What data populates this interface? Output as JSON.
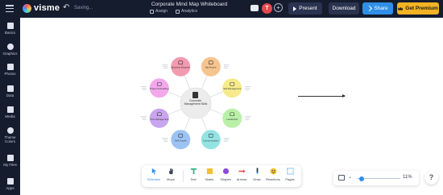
{
  "app": {
    "name": "visme",
    "status": "Saving..."
  },
  "document": {
    "title": "Corporate Mind Map Whiteboard",
    "assign_label": "Assign",
    "analytics_label": "Analytics"
  },
  "header": {
    "avatar_initial": "T",
    "add_label": "+",
    "present_label": "Present",
    "download_label": "Download",
    "share_label": "Share",
    "premium_label": "Get Premium",
    "colors": {
      "bar": "#151c2e",
      "share": "#2f8fe8",
      "premium": "#f2b322",
      "avatar": "#e5484d"
    }
  },
  "sidebar": {
    "items": [
      {
        "label": "Basics",
        "icon": "basics-icon"
      },
      {
        "label": "Graphics",
        "icon": "graphics-icon"
      },
      {
        "label": "Photos",
        "icon": "photos-icon"
      },
      {
        "label": "Data",
        "icon": "data-icon"
      },
      {
        "label": "Media",
        "icon": "media-icon"
      },
      {
        "label": "Theme Colors",
        "icon": "palette-icon"
      },
      {
        "label": "My Files",
        "icon": "folder-icon"
      },
      {
        "label": "Apps",
        "icon": "apps-icon"
      }
    ]
  },
  "mindmap": {
    "center_label": "Corporate Management Skills",
    "nodes": [
      {
        "label": "Business Etiquette",
        "color": "#f29ab0"
      },
      {
        "label": "Big Picture",
        "color": "#f6c48f"
      },
      {
        "label": "Self-Management",
        "color": "#f6ea8c"
      },
      {
        "label": "Leadership",
        "color": "#b9f0a8"
      },
      {
        "label": "Communication",
        "color": "#93e3e3"
      },
      {
        "label": "Self-Growth",
        "color": "#9cc3f2"
      },
      {
        "label": "Time Management",
        "color": "#c9a4ef"
      },
      {
        "label": "Project Scheduling",
        "color": "#f3a8ec"
      }
    ]
  },
  "toolbar": {
    "tools": [
      {
        "label": "Selection",
        "icon": "cursor-icon",
        "active": true
      },
      {
        "label": "Move",
        "icon": "hand-icon",
        "active": false
      },
      {
        "label": "Text",
        "icon": "text-icon",
        "active": false
      },
      {
        "label": "Notes",
        "icon": "sticky-note-icon",
        "active": false
      },
      {
        "label": "Shapes",
        "icon": "shapes-icon",
        "active": false
      },
      {
        "label": "Arrows",
        "icon": "arrow-icon",
        "active": false
      },
      {
        "label": "Draw",
        "icon": "pen-icon",
        "active": false
      },
      {
        "label": "Reactions",
        "icon": "emoji-icon",
        "active": false
      },
      {
        "label": "Pages",
        "icon": "pages-icon",
        "active": false
      }
    ]
  },
  "zoom": {
    "value_label": "11%",
    "level": 0.11
  },
  "help_label": "?"
}
